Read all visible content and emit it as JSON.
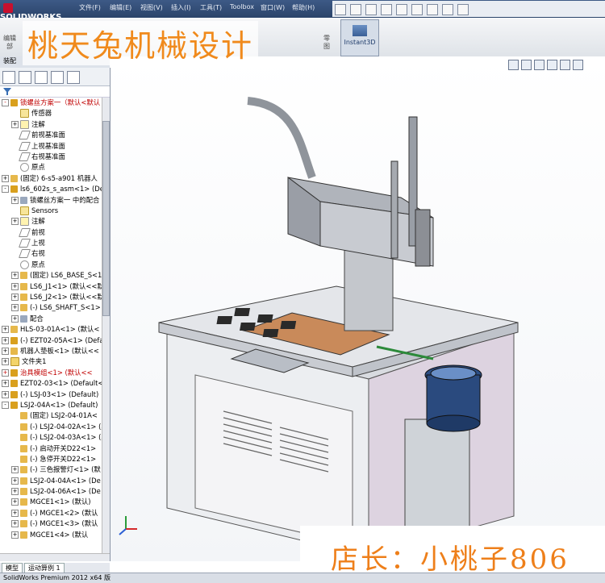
{
  "app": {
    "logo_text": "SOLIDWORKS",
    "brand_color": "#c8102e",
    "menu": [
      "文件(F)",
      "编辑(E)",
      "视图(V)",
      "插入(I)",
      "工具(T)",
      "Toolbox",
      "窗口(W)",
      "帮助(H)"
    ]
  },
  "ribbon": {
    "left_label_1": "编辑",
    "left_label_2": "部",
    "right_label_1": "零",
    "right_label_2": "图",
    "instant3d_label": "Instant3D"
  },
  "watermark": {
    "top_text": "桃天兔机械设计",
    "bottom_text": "店长：小桃子806",
    "color": "#f08a1c"
  },
  "panel": {
    "tab_label": "装配",
    "filter_icon": "filter-icon",
    "tree": [
      {
        "label": "锁螺丝方案一（默认<默认",
        "icon": "asm",
        "indent": 0,
        "expander": "-",
        "red": true
      },
      {
        "label": "传感器",
        "icon": "sens",
        "indent": 1,
        "expander": "",
        "red": false
      },
      {
        "label": "注解",
        "icon": "note",
        "indent": 1,
        "expander": "+",
        "red": false
      },
      {
        "label": "前视基准面",
        "icon": "plane",
        "indent": 1,
        "expander": "",
        "red": false
      },
      {
        "label": "上视基准面",
        "icon": "plane",
        "indent": 1,
        "expander": "",
        "red": false
      },
      {
        "label": "右视基准面",
        "icon": "plane",
        "indent": 1,
        "expander": "",
        "red": false
      },
      {
        "label": "原点",
        "icon": "orig",
        "indent": 1,
        "expander": "",
        "red": false
      },
      {
        "label": "(固定) 6-s5-a901 机器人",
        "icon": "part",
        "indent": 0,
        "expander": "+",
        "red": false
      },
      {
        "label": "ls6_602s_s_asm<1> (De",
        "icon": "asm",
        "indent": 0,
        "expander": "-",
        "red": false
      },
      {
        "label": "锁螺丝方案一 中的配合",
        "icon": "mate",
        "indent": 1,
        "expander": "+",
        "red": false
      },
      {
        "label": "Sensors",
        "icon": "sens",
        "indent": 1,
        "expander": "",
        "red": false
      },
      {
        "label": "注解",
        "icon": "note",
        "indent": 1,
        "expander": "+",
        "red": false
      },
      {
        "label": "前视",
        "icon": "plane",
        "indent": 1,
        "expander": "",
        "red": false
      },
      {
        "label": "上视",
        "icon": "plane",
        "indent": 1,
        "expander": "",
        "red": false
      },
      {
        "label": "右视",
        "icon": "plane",
        "indent": 1,
        "expander": "",
        "red": false
      },
      {
        "label": "原点",
        "icon": "orig",
        "indent": 1,
        "expander": "",
        "red": false
      },
      {
        "label": "(固定) LS6_BASE_S<1",
        "icon": "part",
        "indent": 1,
        "expander": "+",
        "red": false
      },
      {
        "label": "LS6_J1<1> (默认<<默",
        "icon": "part",
        "indent": 1,
        "expander": "+",
        "red": false
      },
      {
        "label": "LS6_J2<1> (默认<<默",
        "icon": "part",
        "indent": 1,
        "expander": "+",
        "red": false
      },
      {
        "label": "(-) LS6_SHAFT_S<1>",
        "icon": "part",
        "indent": 1,
        "expander": "+",
        "red": false
      },
      {
        "label": "配合",
        "icon": "mate",
        "indent": 1,
        "expander": "+",
        "red": false
      },
      {
        "label": "HLS-03-01A<1> (默认<",
        "icon": "part",
        "indent": 0,
        "expander": "+",
        "red": false
      },
      {
        "label": "(-) EZT02-05A<1> (Defa",
        "icon": "asm",
        "indent": 0,
        "expander": "+",
        "red": false
      },
      {
        "label": "机器人垫板<1> (默认<<",
        "icon": "part",
        "indent": 0,
        "expander": "+",
        "red": false
      },
      {
        "label": "文件夹1",
        "icon": "fold",
        "indent": 0,
        "expander": "+",
        "red": false
      },
      {
        "label": "治具模组<1> (默认<<",
        "icon": "asm",
        "indent": 0,
        "expander": "+",
        "red": true
      },
      {
        "label": "EZT02-03<1> (Default<",
        "icon": "asm",
        "indent": 0,
        "expander": "+",
        "red": false
      },
      {
        "label": "(-) LSJ-03<1> (Default)",
        "icon": "asm",
        "indent": 0,
        "expander": "+",
        "red": false
      },
      {
        "label": "LSJ2-04A<1> (Default)",
        "icon": "asm",
        "indent": 0,
        "expander": "-",
        "red": false
      },
      {
        "label": "(固定) LSJ2-04-01A<",
        "icon": "part",
        "indent": 1,
        "expander": "",
        "red": false
      },
      {
        "label": "(-) LSJ2-04-02A<1> (默",
        "icon": "part",
        "indent": 1,
        "expander": "",
        "red": false
      },
      {
        "label": "(-) LSJ2-04-03A<1> (默",
        "icon": "part",
        "indent": 1,
        "expander": "",
        "red": false
      },
      {
        "label": "(-) 启动开关D22<1>",
        "icon": "part",
        "indent": 1,
        "expander": "",
        "red": false
      },
      {
        "label": "(-) 急停开关D22<1>",
        "icon": "part",
        "indent": 1,
        "expander": "",
        "red": false
      },
      {
        "label": "(-) 三色报警灯<1> (默",
        "icon": "part",
        "indent": 1,
        "expander": "+",
        "red": false
      },
      {
        "label": "LSJ2-04-04A<1> (De",
        "icon": "part",
        "indent": 1,
        "expander": "+",
        "red": false
      },
      {
        "label": "LSJ2-04-06A<1> (De",
        "icon": "part",
        "indent": 1,
        "expander": "+",
        "red": false
      },
      {
        "label": "MGCE1<1> (默认)",
        "icon": "part",
        "indent": 1,
        "expander": "+",
        "red": false
      },
      {
        "label": "(-) MGCE1<2> (默认",
        "icon": "part",
        "indent": 1,
        "expander": "+",
        "red": false
      },
      {
        "label": "(-) MGCE1<3> (默认",
        "icon": "part",
        "indent": 1,
        "expander": "+",
        "red": false
      },
      {
        "label": "MGCE1<4> (默认",
        "icon": "part",
        "indent": 1,
        "expander": "+",
        "red": false
      }
    ]
  },
  "bottom_tabs": [
    "模型",
    "运动算例 1"
  ],
  "status": "SolidWorks Premium 2012 x64 版"
}
